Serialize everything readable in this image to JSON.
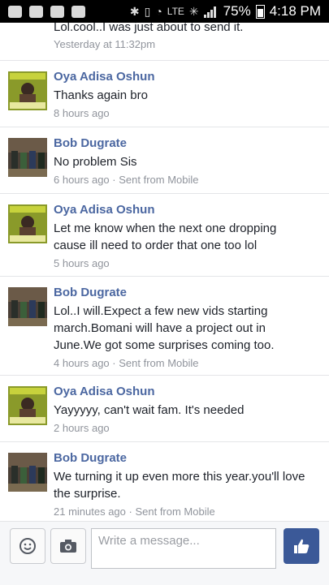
{
  "status_bar": {
    "network": "LTE",
    "battery": "75%",
    "time": "4:18 PM"
  },
  "thread": {
    "partial_message": {
      "text": "Lol.cool..I was just about to send it.",
      "time": "Yesterday at 11:32pm"
    },
    "messages": [
      {
        "sender": "Oya Adisa Oshun",
        "lines": [
          "Thanks again bro"
        ],
        "time": "8 hours ago",
        "via": ""
      },
      {
        "sender": "Bob Dugrate",
        "lines": [
          "No problem Sis"
        ],
        "time": "6 hours ago",
        "via": " · Sent from Mobile"
      },
      {
        "sender": "Oya Adisa Oshun",
        "lines": [
          "Let me know when the next one dropping",
          "cause ill need to order that one too lol"
        ],
        "time": "5 hours ago",
        "via": ""
      },
      {
        "sender": "Bob Dugrate",
        "lines": [
          "Lol..I will.Expect a few new vids starting",
          "march.Bomani will have a project out in",
          "June.We got some surprises coming too."
        ],
        "time": "4 hours ago",
        "via": " · Sent from Mobile"
      },
      {
        "sender": "Oya Adisa Oshun",
        "lines": [
          "Yayyyyy, can't wait fam. It's needed"
        ],
        "time": "2 hours ago",
        "via": ""
      },
      {
        "sender": "Bob Dugrate",
        "lines": [
          "We turning it up even more this year.you'll love",
          "the surprise."
        ],
        "time": "21 minutes ago",
        "via": " · Sent from Mobile"
      }
    ]
  },
  "composer": {
    "placeholder": "Write a message...",
    "icons": [
      "smiley-icon",
      "camera-icon",
      "thumbs-up-icon"
    ]
  },
  "colors": {
    "name": "#4b67a1",
    "meta": "#90949c",
    "like_button": "#3b5998"
  }
}
